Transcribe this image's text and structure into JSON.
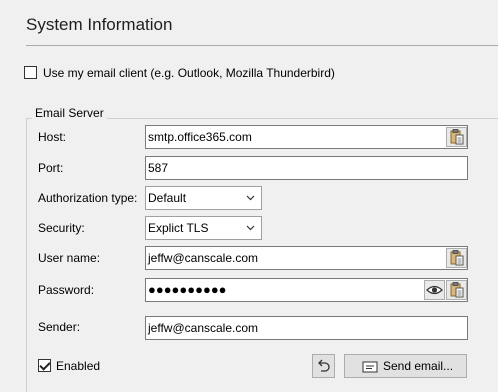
{
  "page": {
    "title": "System Information"
  },
  "use_client": {
    "label": "Use my email client (e.g. Outlook, Mozilla Thunderbird)",
    "checked": false
  },
  "email_server": {
    "legend": "Email Server",
    "host": {
      "label": "Host:",
      "value": "smtp.office365.com"
    },
    "port": {
      "label": "Port:",
      "value": "587"
    },
    "auth": {
      "label": "Authorization type:",
      "value": "Default"
    },
    "security": {
      "label": "Security:",
      "value": "Explict TLS"
    },
    "username": {
      "label": "User name:",
      "value": "jeffw@canscale.com"
    },
    "password": {
      "label": "Password:",
      "value": "●●●●●●●●●●"
    },
    "sender": {
      "label": "Sender:",
      "value": "jeffw@canscale.com"
    },
    "enabled": {
      "label": "Enabled",
      "checked": true
    },
    "send_email_label": "Send email...",
    "icons": {
      "paste": "clipboard-paste-icon",
      "show_password": "eye-icon",
      "undo": "undo-arrow-icon",
      "send": "envelope-icon",
      "dropdown": "chevron-down-icon"
    }
  }
}
